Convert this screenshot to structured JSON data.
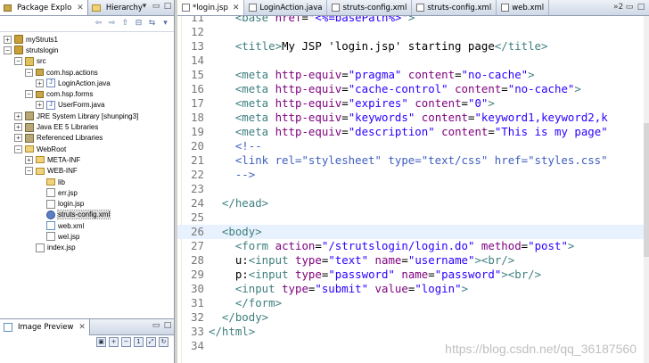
{
  "left_panel": {
    "tabs": [
      {
        "label": "Package Explo",
        "active": true
      },
      {
        "label": "Hierarchy",
        "active": false
      }
    ],
    "tree": [
      {
        "depth": 0,
        "exp": "+",
        "icon": "proj",
        "label": "myStruts1"
      },
      {
        "depth": 0,
        "exp": "-",
        "icon": "proj",
        "label": "strutslogin"
      },
      {
        "depth": 1,
        "exp": "-",
        "icon": "src",
        "label": "src"
      },
      {
        "depth": 2,
        "exp": "-",
        "icon": "pkg",
        "label": "com.hsp.actions"
      },
      {
        "depth": 3,
        "exp": "+",
        "icon": "java",
        "label": "LoginAction.java"
      },
      {
        "depth": 2,
        "exp": "-",
        "icon": "pkg",
        "label": "com.hsp.forms"
      },
      {
        "depth": 3,
        "exp": "+",
        "icon": "java",
        "label": "UserForm.java"
      },
      {
        "depth": 1,
        "exp": "+",
        "icon": "lib",
        "label": "JRE System Library [shunping3]"
      },
      {
        "depth": 1,
        "exp": "+",
        "icon": "lib",
        "label": "Java EE 5 Libraries"
      },
      {
        "depth": 1,
        "exp": "+",
        "icon": "lib",
        "label": "Referenced Libraries"
      },
      {
        "depth": 1,
        "exp": "-",
        "icon": "folder",
        "label": "WebRoot"
      },
      {
        "depth": 2,
        "exp": "+",
        "icon": "folder",
        "label": "META-INF"
      },
      {
        "depth": 2,
        "exp": "-",
        "icon": "folder",
        "label": "WEB-INF"
      },
      {
        "depth": 3,
        "exp": "",
        "icon": "folder",
        "label": "lib"
      },
      {
        "depth": 3,
        "exp": "",
        "icon": "jsp",
        "label": "err.jsp"
      },
      {
        "depth": 3,
        "exp": "",
        "icon": "jsp",
        "label": "login.jsp"
      },
      {
        "depth": 3,
        "exp": "",
        "icon": "gear",
        "label": "struts-config.xml",
        "selected": true
      },
      {
        "depth": 3,
        "exp": "",
        "icon": "xml",
        "label": "web.xml"
      },
      {
        "depth": 3,
        "exp": "",
        "icon": "jsp",
        "label": "wel.jsp"
      },
      {
        "depth": 2,
        "exp": "",
        "icon": "jsp",
        "label": "index.jsp"
      }
    ]
  },
  "preview_panel": {
    "tab_label": "Image Preview"
  },
  "editor": {
    "tabs": [
      {
        "label": "*login.jsp",
        "active": true
      },
      {
        "label": "LoginAction.java",
        "active": false
      },
      {
        "label": "struts-config.xml",
        "active": false
      },
      {
        "label": "struts-config.xml",
        "active": false
      },
      {
        "label": "web.xml",
        "active": false
      }
    ],
    "overflow_count": "»2",
    "current_line": 26,
    "lines": [
      {
        "n": "11",
        "tokens": [
          [
            "txt",
            "    "
          ],
          [
            "tag",
            "<base"
          ],
          [
            "txt",
            " "
          ],
          [
            "attr",
            "href"
          ],
          [
            "txt",
            "="
          ],
          [
            "val",
            "\"<%=basePath%>\""
          ],
          [
            "tag",
            ">"
          ]
        ]
      },
      {
        "n": "12",
        "tokens": [
          [
            "txt",
            ""
          ]
        ]
      },
      {
        "n": "13",
        "tokens": [
          [
            "txt",
            "    "
          ],
          [
            "tag",
            "<title>"
          ],
          [
            "txt",
            "My JSP 'login.jsp' starting page"
          ],
          [
            "tag",
            "</title>"
          ]
        ]
      },
      {
        "n": "14",
        "tokens": [
          [
            "txt",
            ""
          ]
        ]
      },
      {
        "n": "15",
        "tokens": [
          [
            "txt",
            "    "
          ],
          [
            "tag",
            "<meta"
          ],
          [
            "txt",
            " "
          ],
          [
            "attr",
            "http-equiv"
          ],
          [
            "txt",
            "="
          ],
          [
            "val",
            "\"pragma\""
          ],
          [
            "txt",
            " "
          ],
          [
            "attr",
            "content"
          ],
          [
            "txt",
            "="
          ],
          [
            "val",
            "\"no-cache\""
          ],
          [
            "tag",
            ">"
          ]
        ]
      },
      {
        "n": "16",
        "tokens": [
          [
            "txt",
            "    "
          ],
          [
            "tag",
            "<meta"
          ],
          [
            "txt",
            " "
          ],
          [
            "attr",
            "http-equiv"
          ],
          [
            "txt",
            "="
          ],
          [
            "val",
            "\"cache-control\""
          ],
          [
            "txt",
            " "
          ],
          [
            "attr",
            "content"
          ],
          [
            "txt",
            "="
          ],
          [
            "val",
            "\"no-cache\""
          ],
          [
            "tag",
            ">"
          ]
        ]
      },
      {
        "n": "17",
        "tokens": [
          [
            "txt",
            "    "
          ],
          [
            "tag",
            "<meta"
          ],
          [
            "txt",
            " "
          ],
          [
            "attr",
            "http-equiv"
          ],
          [
            "txt",
            "="
          ],
          [
            "val",
            "\"expires\""
          ],
          [
            "txt",
            " "
          ],
          [
            "attr",
            "content"
          ],
          [
            "txt",
            "="
          ],
          [
            "val",
            "\"0\""
          ],
          [
            "tag",
            ">"
          ]
        ]
      },
      {
        "n": "18",
        "tokens": [
          [
            "txt",
            "    "
          ],
          [
            "tag",
            "<meta"
          ],
          [
            "txt",
            " "
          ],
          [
            "attr",
            "http-equiv"
          ],
          [
            "txt",
            "="
          ],
          [
            "val",
            "\"keywords\""
          ],
          [
            "txt",
            " "
          ],
          [
            "attr",
            "content"
          ],
          [
            "txt",
            "="
          ],
          [
            "val",
            "\"keyword1,keyword2,k"
          ]
        ]
      },
      {
        "n": "19",
        "tokens": [
          [
            "txt",
            "    "
          ],
          [
            "tag",
            "<meta"
          ],
          [
            "txt",
            " "
          ],
          [
            "attr",
            "http-equiv"
          ],
          [
            "txt",
            "="
          ],
          [
            "val",
            "\"description\""
          ],
          [
            "txt",
            " "
          ],
          [
            "attr",
            "content"
          ],
          [
            "txt",
            "="
          ],
          [
            "val",
            "\"This is my page\""
          ]
        ]
      },
      {
        "n": "20",
        "tokens": [
          [
            "txt",
            "    "
          ],
          [
            "com",
            "<!--"
          ]
        ]
      },
      {
        "n": "21",
        "tokens": [
          [
            "txt",
            "    "
          ],
          [
            "com",
            "<link rel=\"stylesheet\" type=\"text/css\" href=\"styles.css\""
          ]
        ]
      },
      {
        "n": "22",
        "tokens": [
          [
            "txt",
            "    "
          ],
          [
            "com",
            "-->"
          ]
        ]
      },
      {
        "n": "23",
        "tokens": [
          [
            "txt",
            ""
          ]
        ]
      },
      {
        "n": "24",
        "tokens": [
          [
            "txt",
            "  "
          ],
          [
            "tag",
            "</head>"
          ]
        ]
      },
      {
        "n": "25",
        "tokens": [
          [
            "txt",
            ""
          ]
        ]
      },
      {
        "n": "26",
        "tokens": [
          [
            "txt",
            "  "
          ],
          [
            "tag",
            "<body>"
          ]
        ]
      },
      {
        "n": "27",
        "tokens": [
          [
            "txt",
            "    "
          ],
          [
            "tag",
            "<form"
          ],
          [
            "txt",
            " "
          ],
          [
            "attr",
            "action"
          ],
          [
            "txt",
            "="
          ],
          [
            "val",
            "\"/strutslogin/login.do\""
          ],
          [
            "txt",
            " "
          ],
          [
            "attr",
            "method"
          ],
          [
            "txt",
            "="
          ],
          [
            "val",
            "\"post\""
          ],
          [
            "tag",
            ">"
          ]
        ]
      },
      {
        "n": "28",
        "tokens": [
          [
            "txt",
            "    u:"
          ],
          [
            "tag",
            "<input"
          ],
          [
            "txt",
            " "
          ],
          [
            "attr",
            "type"
          ],
          [
            "txt",
            "="
          ],
          [
            "val",
            "\"text\""
          ],
          [
            "txt",
            " "
          ],
          [
            "attr",
            "name"
          ],
          [
            "txt",
            "="
          ],
          [
            "val",
            "\"username\""
          ],
          [
            "tag",
            "><br/>"
          ]
        ]
      },
      {
        "n": "29",
        "tokens": [
          [
            "txt",
            "    p:"
          ],
          [
            "tag",
            "<input"
          ],
          [
            "txt",
            " "
          ],
          [
            "attr",
            "type"
          ],
          [
            "txt",
            "="
          ],
          [
            "val",
            "\"password\""
          ],
          [
            "txt",
            " "
          ],
          [
            "attr",
            "name"
          ],
          [
            "txt",
            "="
          ],
          [
            "val",
            "\"password\""
          ],
          [
            "tag",
            "><br/>"
          ]
        ]
      },
      {
        "n": "30",
        "tokens": [
          [
            "txt",
            "    "
          ],
          [
            "tag",
            "<input"
          ],
          [
            "txt",
            " "
          ],
          [
            "attr",
            "type"
          ],
          [
            "txt",
            "="
          ],
          [
            "val",
            "\"submit\""
          ],
          [
            "txt",
            " "
          ],
          [
            "attr",
            "value"
          ],
          [
            "txt",
            "="
          ],
          [
            "val",
            "\"login\""
          ],
          [
            "tag",
            ">"
          ]
        ]
      },
      {
        "n": "31",
        "tokens": [
          [
            "txt",
            "    "
          ],
          [
            "tag",
            "</form>"
          ]
        ]
      },
      {
        "n": "32",
        "tokens": [
          [
            "txt",
            "  "
          ],
          [
            "tag",
            "</body>"
          ]
        ]
      },
      {
        "n": "33",
        "tokens": [
          [
            "tag",
            "</html>"
          ]
        ]
      },
      {
        "n": "34",
        "tokens": [
          [
            "txt",
            ""
          ]
        ]
      }
    ]
  },
  "watermark": "https://blog.csdn.net/qq_36187560"
}
